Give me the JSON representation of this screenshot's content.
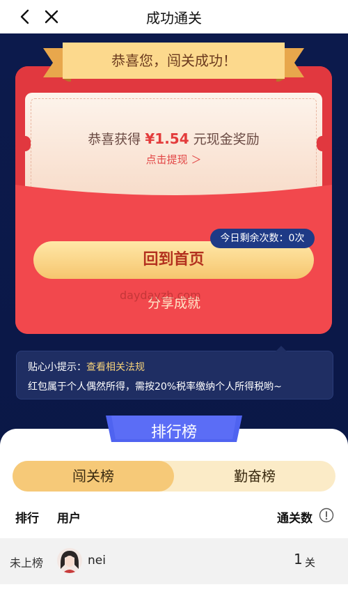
{
  "topbar": {
    "title": "成功通关"
  },
  "banner": {
    "text": "恭喜您，闯关成功！"
  },
  "reward": {
    "prefix": "恭喜获得",
    "amount": "¥1.54",
    "suffix": "元现金奖励",
    "withdraw": "点击提现 ＞"
  },
  "chances": "今日剩余次数：0次",
  "buttons": {
    "home": "回到首页",
    "share": "分享成就"
  },
  "watermark": "daydayzh.com",
  "tips": {
    "label": "贴心小提示：",
    "link": "查看相关法规",
    "text": "红包属于个人偶然所得，需按20%税率缴纳个人所得税哟~"
  },
  "ranking": {
    "title": "排行榜",
    "tabs": [
      "闯关榜",
      "勤奋榜"
    ],
    "active_tab": "闯关榜",
    "headers": {
      "rank": "排行",
      "user": "用户",
      "count": "通关数"
    },
    "rows": [
      {
        "rank": "未上榜",
        "user": "nei",
        "count": "1",
        "unit": "关"
      }
    ]
  },
  "colors": {
    "envelope": "#f0494e",
    "background": "#0c1a4a",
    "accent_gold": "#f6c978",
    "amount_red": "#e33c3c"
  },
  "icons": [
    "back-arrow-icon",
    "close-icon",
    "info-icon",
    "avatar-image"
  ]
}
